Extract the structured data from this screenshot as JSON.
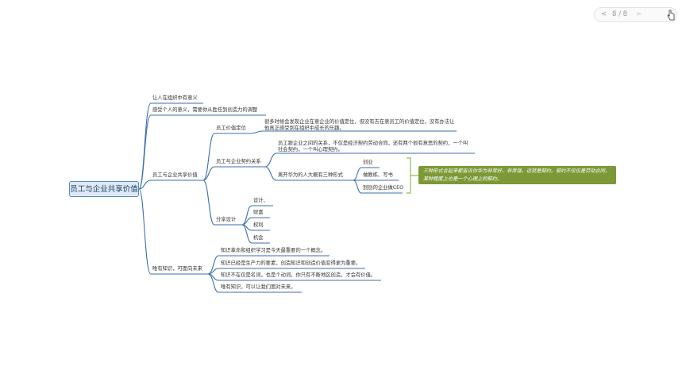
{
  "pager": {
    "text": "8 / 8",
    "prev": "<",
    "next": ">"
  },
  "root": "员工与企业共享价值",
  "branch1": "让人在组织中有意义",
  "branch2": "感受个人的意义，需要你从胜任到创造力的调整",
  "branch3": {
    "label": "员工与企业共享价值",
    "value_position": {
      "label": "员工价值定位",
      "text_line1": "很多时候会发现企业在意企业的价值定位，但没有去在意员工的价值定位，没有办法让",
      "text_line2": "他真正感受到在组织中成长的乐趣。"
    },
    "contract": {
      "label": "员工与企业契约关系",
      "text_line1": "员工跟企业之间的关系，不仅是经济契约劳动合同，还有两个很有意思的契约，一个叫",
      "text_line2": "社会契约，一个叫心理契约。",
      "huawei": {
        "label": "离开华为的人大概有三种形式",
        "items": [
          "创业",
          "做教练、写书",
          "到别的企业做CEO"
        ]
      }
    },
    "share": {
      "label": "分享设计",
      "items": [
        "设计、",
        "财富",
        "权利",
        "机会"
      ]
    }
  },
  "branch4": {
    "label": "唯有知识，可面向未来",
    "items": [
      "知识革命和组织学习是今天最重要的一个概念。",
      "知识已经是生产力的要素，创造知识和创造价值变得更为重要。",
      "知识不在仅是名词，也是个动词，你只有不断地区创造，才会有价值。",
      "唯有知识，可以让我们面对未来。"
    ]
  },
  "callout": {
    "line1": "三种形式合起来都告诉你华为非常好，非常强，这就是契约。契约不仅仅是劳动合同，",
    "line2": "某种程度上也是一个心理上的契约。"
  },
  "colors": {
    "line": "#3b6fae",
    "callout": "#7b9936",
    "bracket": "#a6c36e",
    "root_fill": "#dde9f6"
  }
}
